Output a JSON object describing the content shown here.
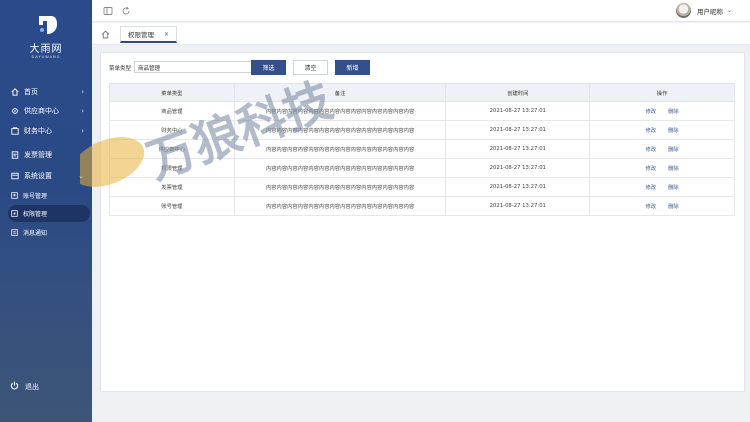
{
  "brand": {
    "name": "大雨网",
    "sub": "DAYUWANG"
  },
  "sidebar": {
    "items": [
      {
        "label": "首页",
        "icon": "home-icon",
        "arrow": "›"
      },
      {
        "label": "供应商中心",
        "icon": "gear-icon",
        "arrow": "›"
      },
      {
        "label": "财务中心",
        "icon": "wallet-icon",
        "arrow": "›"
      },
      {
        "label": "发票管理",
        "icon": "invoice-icon",
        "arrow": ""
      },
      {
        "label": "系统设置",
        "icon": "settings-icon",
        "arrow": "⌄"
      }
    ],
    "sub_items": [
      {
        "label": "账号管理"
      },
      {
        "label": "权限管理"
      },
      {
        "label": "消息通知"
      }
    ],
    "logout": "退出"
  },
  "topbar": {
    "user_name": "用户昵称",
    "caret": "⌄"
  },
  "tabs": {
    "active_label": "权限管理",
    "close": "×"
  },
  "filter": {
    "label": "菜单类型",
    "value": "商品管理",
    "search_btn": "筛选",
    "clear_btn": "清空",
    "add_btn": "新增"
  },
  "table": {
    "headers": [
      "菜单类型",
      "备注",
      "创建时间",
      "操作"
    ],
    "rows": [
      {
        "type": "商品管理",
        "note": "内容内容内容内容内容内容内容内容内容内容内容内容内容内容",
        "time": "2021-08-27 13:27:01"
      },
      {
        "type": "财务中心",
        "note": "内容内容内容内容内容内容内容内容内容内容内容内容内容内容",
        "time": "2021-08-27 13:27:01"
      },
      {
        "type": "供应商中心",
        "note": "内容内容内容内容内容内容内容内容内容内容内容内容内容内容",
        "time": "2021-08-27 13:27:01"
      },
      {
        "type": "权限管理",
        "note": "内容内容内容内容内容内容内容内容内容内容内容内容内容内容",
        "time": "2021-08-27 13:27:01"
      },
      {
        "type": "发票管理",
        "note": "内容内容内容内容内容内容内容内容内容内容内容内容内容内容",
        "time": "2021-08-27 13:27:01"
      },
      {
        "type": "账号管理",
        "note": "内容内容内容内容内容内容内容内容内容内容内容内容内容内容",
        "time": "2021-08-27 13:27:01"
      }
    ],
    "edit_label": "修改",
    "delete_label": "删除"
  },
  "watermark": {
    "text": "万狼科技"
  },
  "colors": {
    "primary": "#33508a",
    "sidebar": "#2b4a8a",
    "accent_gold": "#e8b13a"
  }
}
